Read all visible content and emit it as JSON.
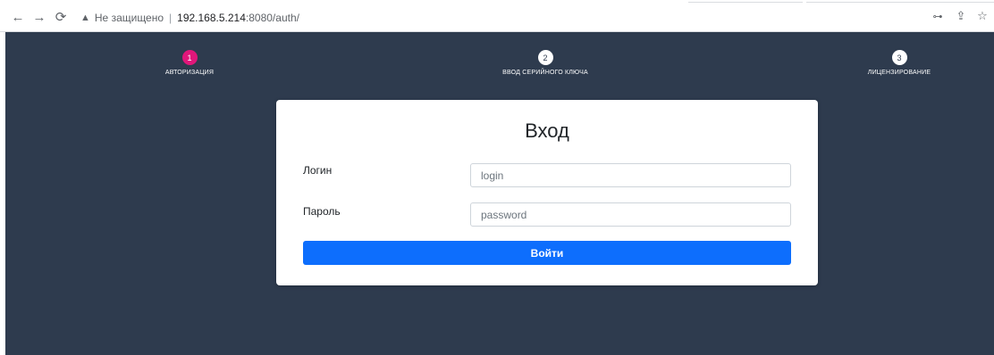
{
  "browser": {
    "security_label": "Не защищено",
    "url_host": "192.168.5.214",
    "url_rest": ":8080/auth/",
    "icons": {
      "back": "arrow-left-icon",
      "forward": "arrow-right-icon",
      "reload": "reload-icon",
      "warning": "warning-triangle-icon",
      "key": "key-icon",
      "share": "share-icon",
      "star": "star-icon"
    }
  },
  "steps": [
    {
      "number": "1",
      "label": "АВТОРИЗАЦИЯ",
      "active": true
    },
    {
      "number": "2",
      "label": "ВВОД СЕРИЙНОГО КЛЮЧА",
      "active": false
    },
    {
      "number": "3",
      "label": "ЛИЦЕНЗИРОВАНИЕ",
      "active": false
    }
  ],
  "form": {
    "title": "Вход",
    "login_label": "Логин",
    "login_placeholder": "login",
    "login_value": "",
    "password_label": "Пароль",
    "password_placeholder": "password",
    "password_value": "",
    "submit_label": "Войти"
  },
  "colors": {
    "page_background": "#2e3b4e",
    "active_step": "#e0177a",
    "primary_button": "#0d6efd"
  }
}
